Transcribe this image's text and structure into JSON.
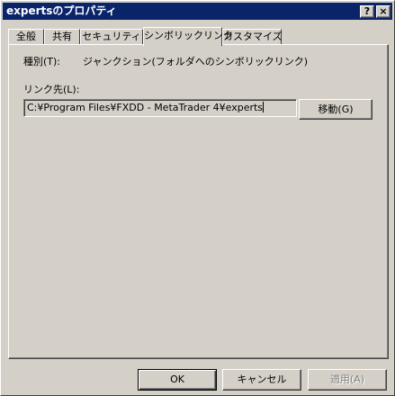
{
  "window": {
    "title": "expertsのプロパティ"
  },
  "titlebar": {
    "help_glyph": "?",
    "close_glyph": "×"
  },
  "tabs": [
    {
      "label": "全般"
    },
    {
      "label": "共有"
    },
    {
      "label": "セキュリティ"
    },
    {
      "label": "シンボリックリンク",
      "active": true
    },
    {
      "label": "カスタマイズ"
    }
  ],
  "symlink": {
    "type_label": "種別(T):",
    "type_value": "ジャンクション(フォルダへのシンボリックリンク)",
    "target_label": "リンク先(L):",
    "target_value": "C:¥Program Files¥FXDD - MetaTrader 4¥experts",
    "move_button": "移動(G)"
  },
  "footer": {
    "ok": "OK",
    "cancel": "キャンセル",
    "apply": "適用(A)"
  }
}
